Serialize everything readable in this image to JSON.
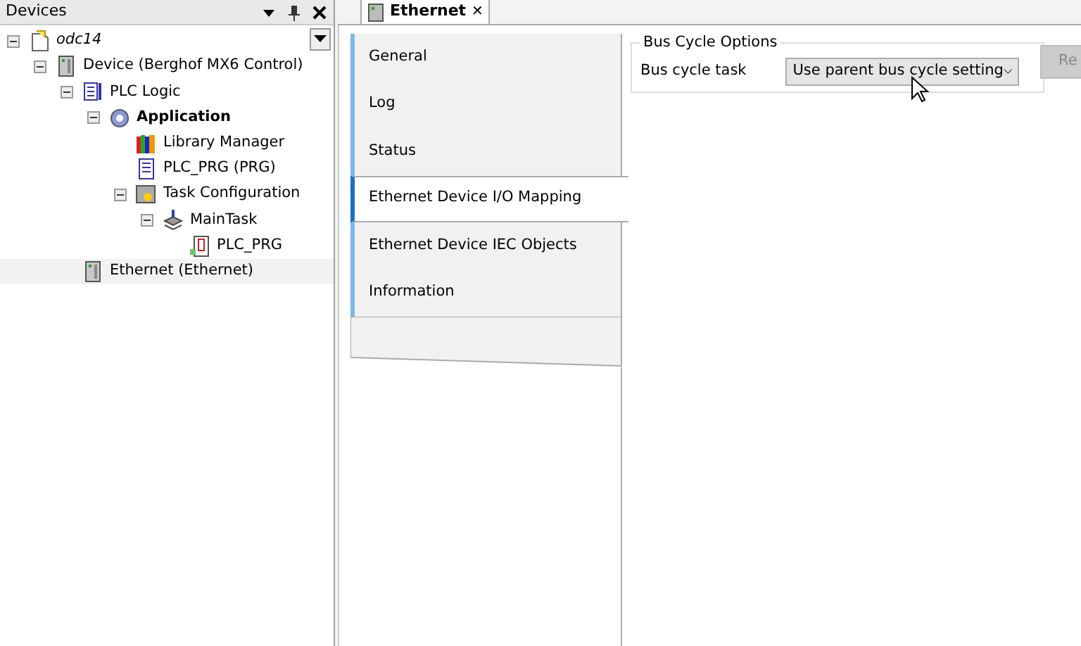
{
  "devices_panel": {
    "title": "Devices",
    "tree": [
      {
        "label": "odc14",
        "kind": "project",
        "italic": true,
        "expanded": true,
        "selected": false,
        "children": [
          {
            "label": "Device (Berghof MX6 Control)",
            "kind": "device",
            "expanded": true,
            "selected": false,
            "children": [
              {
                "label": "PLC Logic",
                "kind": "plc",
                "expanded": true,
                "selected": false,
                "children": [
                  {
                    "label": "Application",
                    "kind": "application",
                    "bold": true,
                    "expanded": true,
                    "selected": false,
                    "children": [
                      {
                        "label": "Library Manager",
                        "kind": "library",
                        "selected": false
                      },
                      {
                        "label": "PLC_PRG (PRG)",
                        "kind": "program",
                        "selected": false
                      },
                      {
                        "label": "Task Configuration",
                        "kind": "taskconfig",
                        "expanded": true,
                        "selected": false,
                        "children": [
                          {
                            "label": "MainTask",
                            "kind": "task",
                            "expanded": true,
                            "selected": false,
                            "children": [
                              {
                                "label": "PLC_PRG",
                                "kind": "call",
                                "selected": false
                              }
                            ]
                          }
                        ]
                      }
                    ]
                  }
                ]
              },
              {
                "label": "Ethernet (Ethernet)",
                "kind": "device",
                "selected": true
              }
            ]
          }
        ]
      }
    ]
  },
  "editor_tab": {
    "label": "Ethernet",
    "close": "✕"
  },
  "side_tabs": [
    {
      "label": "General",
      "selected": false
    },
    {
      "label": "Log",
      "selected": false
    },
    {
      "label": "Status",
      "selected": false
    },
    {
      "label": "Ethernet Device I/O Mapping",
      "selected": true
    },
    {
      "label": "Ethernet Device IEC Objects",
      "selected": false
    },
    {
      "label": "Information",
      "selected": false
    }
  ],
  "bus_cycle_options": {
    "title": "Bus Cycle Options",
    "label": "Bus cycle task",
    "value": "Use parent bus cycle setting",
    "button": "Re",
    "button_disabled": true
  }
}
